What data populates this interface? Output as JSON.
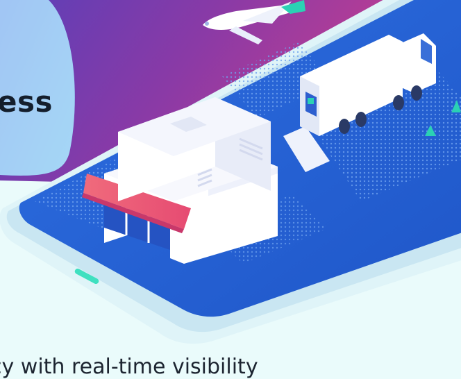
{
  "hero": {
    "heading_fragment": "ess",
    "subtext_fragment": "cy with real-time visibility"
  },
  "colors": {
    "page_bg": "#eafbfb",
    "headline": "#141e2c",
    "purple": "#7a39a8",
    "magenta": "#c43f8e",
    "phone_screen": "#2a66d6",
    "awning": "#ef5d7a"
  },
  "icons": [
    "airplane-icon",
    "truck-icon",
    "store-icon",
    "tshirt-icon",
    "map-dots"
  ]
}
